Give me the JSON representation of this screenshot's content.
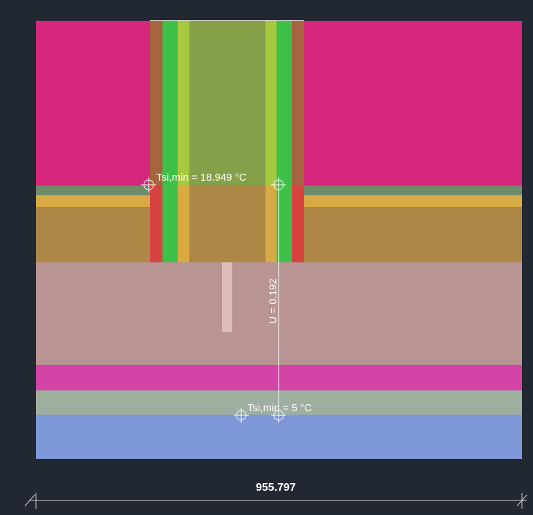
{
  "annotations": {
    "tsi_upper": "Tsi,min = 18.949 °C",
    "tsi_lower": "Tsi,min = 5 °C",
    "u_value": "U = 0.192"
  },
  "dimension": {
    "width_label": "955.797"
  },
  "colors": {
    "background": "#222831",
    "magenta_block": "#d6267d",
    "core_green": "#86a04a",
    "insulation_green": "#3fc149",
    "light_green": "#a7c940",
    "brown_wood": "#ad8745",
    "red_strip": "#d7443f",
    "rust_strip": "#a6653f",
    "yellow_band": "#d8aa43",
    "gray_green_band": "#6e8b6a",
    "mauve_slab": "#b89593",
    "pink_band": "#d444a7",
    "sage_band": "#9eae9f",
    "blue_base": "#7e97d6",
    "light_pink_bar": "#dcbcb8",
    "annotation_line": "#ffffff"
  }
}
